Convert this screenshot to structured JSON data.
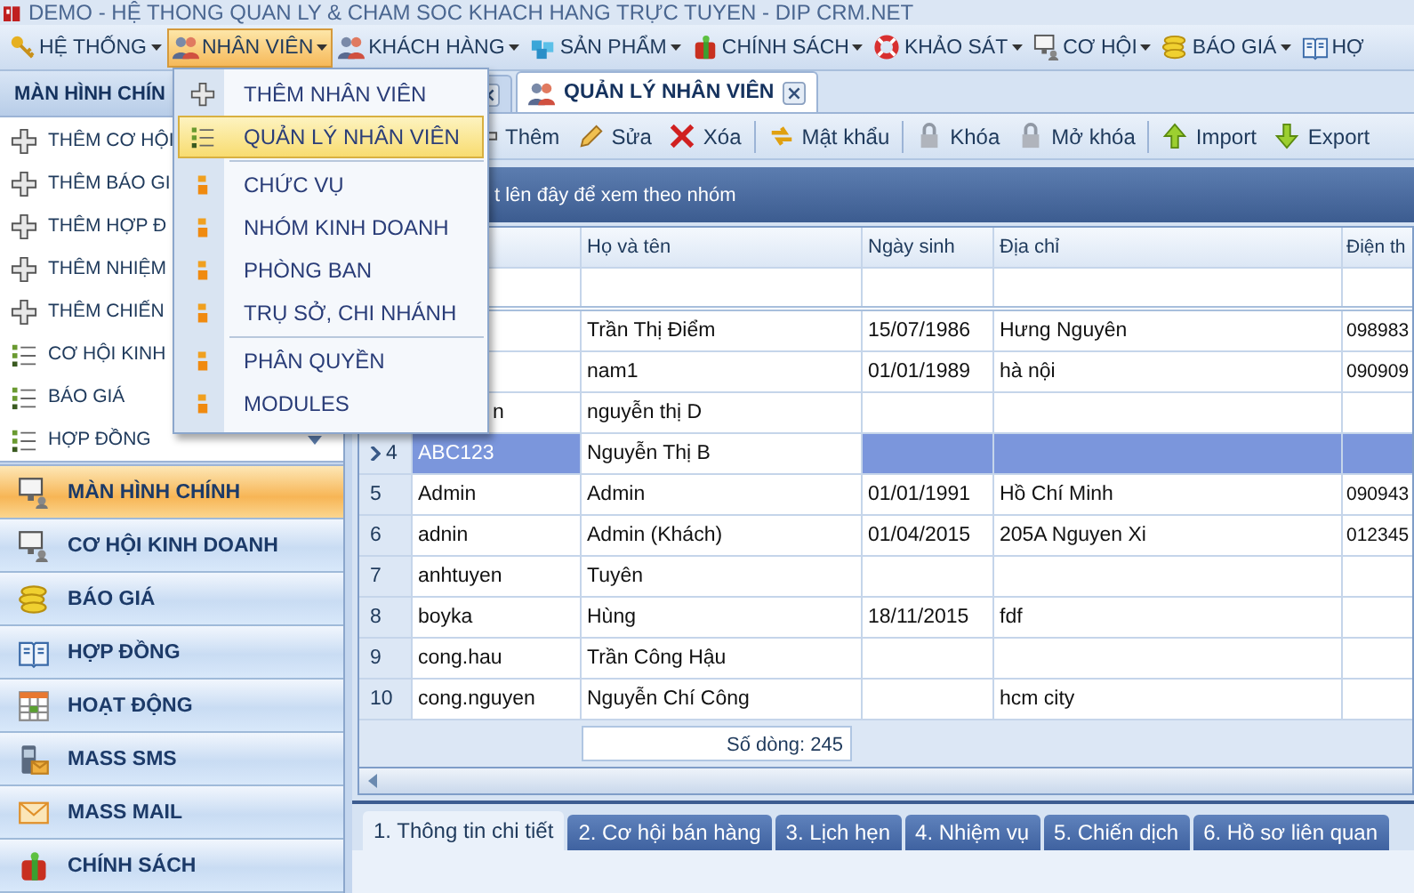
{
  "window": {
    "title": "DEMO - HỆ THONG QUAN LY & CHAM SOC KHACH HANG TRỰC TUYEN - DIP CRM.NET"
  },
  "menu_bar": [
    {
      "label": "HỆ THỐNG",
      "open": false,
      "caret": true
    },
    {
      "label": "NHÂN VIÊN",
      "open": true,
      "caret": true
    },
    {
      "label": "KHÁCH HÀNG",
      "open": false,
      "caret": true
    },
    {
      "label": "SẢN PHẨM",
      "open": false,
      "caret": true
    },
    {
      "label": "CHÍNH SÁCH",
      "open": false,
      "caret": true
    },
    {
      "label": "KHẢO SÁT",
      "open": false,
      "caret": true
    },
    {
      "label": "CƠ HỘI",
      "open": false,
      "caret": true
    },
    {
      "label": "BÁO GIÁ",
      "open": false,
      "caret": true
    },
    {
      "label": "HỢ",
      "open": false,
      "caret": false
    }
  ],
  "sidebar": {
    "header": "MÀN HÌNH CHÍN",
    "collapse_toggle": true,
    "items": [
      {
        "kind": "add",
        "label": "THÊM CƠ HỘI"
      },
      {
        "kind": "add",
        "label": "THÊM BÁO GI"
      },
      {
        "kind": "add",
        "label": "THÊM HỢP Đ"
      },
      {
        "kind": "add",
        "label": "THÊM NHIỆM"
      },
      {
        "kind": "add",
        "label": "THÊM CHIẾN"
      },
      {
        "kind": "list",
        "label": "CƠ HỘI KINH"
      },
      {
        "kind": "list",
        "label": "BÁO GIÁ"
      },
      {
        "kind": "list",
        "label": "HỢP ĐỒNG"
      }
    ]
  },
  "nav": [
    {
      "label": "MÀN HÌNH CHÍNH",
      "selected": true
    },
    {
      "label": "CƠ HỘI KINH DOANH",
      "selected": false
    },
    {
      "label": "BÁO GIÁ",
      "selected": false
    },
    {
      "label": "HỢP ĐỒNG",
      "selected": false
    },
    {
      "label": "HOẠT ĐỘNG",
      "selected": false
    },
    {
      "label": "MASS SMS",
      "selected": false
    },
    {
      "label": "MASS MAIL",
      "selected": false
    },
    {
      "label": "CHÍNH SÁCH",
      "selected": false
    }
  ],
  "dropdown": {
    "groups": [
      [
        {
          "kind": "add",
          "label": "THÊM NHÂN VIÊN",
          "highlighted": false
        },
        {
          "kind": "list",
          "label": "QUẢN LÝ NHÂN VIÊN",
          "highlighted": true
        }
      ],
      [
        {
          "kind": "folder",
          "label": "CHỨC VỤ",
          "highlighted": false
        },
        {
          "kind": "folder",
          "label": "NHÓM KINH DOANH",
          "highlighted": false
        },
        {
          "kind": "folder",
          "label": "PHÒNG BAN",
          "highlighted": false
        },
        {
          "kind": "folder",
          "label": "TRỤ SỞ, CHI NHÁNH",
          "highlighted": false
        }
      ],
      [
        {
          "kind": "folder",
          "label": "PHÂN QUYỀN",
          "highlighted": false
        },
        {
          "kind": "folder",
          "label": "MODULES",
          "highlighted": false
        }
      ]
    ]
  },
  "tabs": [
    {
      "selected": false
    },
    {
      "label": "QUẢN LÝ NHÂN VIÊN",
      "selected": true
    }
  ],
  "toolbar": [
    {
      "label": "Thêm"
    },
    {
      "label": "Sửa"
    },
    {
      "label": "Xóa"
    },
    {
      "label": "Mật khẩu"
    },
    {
      "label": "Khóa"
    },
    {
      "label": "Mở khóa"
    },
    {
      "label": "Import"
    },
    {
      "label": "Export"
    }
  ],
  "group_panel": {
    "hint": "t lên đây để xem theo nhóm"
  },
  "grid": {
    "columns": [
      "Họ và tên",
      "Ngày sinh",
      "Địa chỉ",
      "Điện th"
    ],
    "rows": [
      {
        "selected": false,
        "full_name": "Trần Thị Điểm",
        "birth_date": "15/07/1986",
        "address": "Hưng Nguyên",
        "phone": "098983"
      },
      {
        "selected": false,
        "full_name": "nam1",
        "birth_date": "01/01/1989",
        "address": "hà nội",
        "phone": "090909"
      },
      {
        "selected": false,
        "username": "n",
        "full_name": "nguyễn thị D"
      },
      {
        "selected": true,
        "num": "4",
        "username": "ABC123",
        "full_name": "Nguyễn Thị B"
      },
      {
        "selected": false,
        "num": "5",
        "username": "Admin",
        "full_name": "Admin",
        "birth_date": "01/01/1991",
        "address": "Hồ Chí Minh",
        "phone": "090943"
      },
      {
        "selected": false,
        "num": "6",
        "username": "adnin",
        "full_name": "Admin (Khách)",
        "birth_date": "01/04/2015",
        "address": "205A Nguyen Xi",
        "phone": "012345"
      },
      {
        "selected": false,
        "num": "7",
        "username": "anhtuyen",
        "full_name": "Tuyên"
      },
      {
        "selected": false,
        "num": "8",
        "username": "boyka",
        "full_name": "Hùng",
        "birth_date": "18/11/2015",
        "address": "fdf"
      },
      {
        "selected": false,
        "num": "9",
        "username": "cong.hau",
        "full_name": "Trần Công Hậu"
      },
      {
        "selected": false,
        "num": "10",
        "username": "cong.nguyen",
        "full_name": "Nguyễn Chí Công",
        "address": "hcm city"
      }
    ],
    "footer": "Số dòng: 245"
  },
  "bottom_tabs": [
    {
      "label": "1. Thông tin chi tiết",
      "selected": true
    },
    {
      "label": "2. Cơ hội bán hàng",
      "selected": false
    },
    {
      "label": "3. Lịch hẹn",
      "selected": false
    },
    {
      "label": "4. Nhiệm vụ",
      "selected": false
    },
    {
      "label": "5. Chiến dịch",
      "selected": false
    },
    {
      "label": "6. Hồ sơ liên quan",
      "selected": false
    }
  ]
}
